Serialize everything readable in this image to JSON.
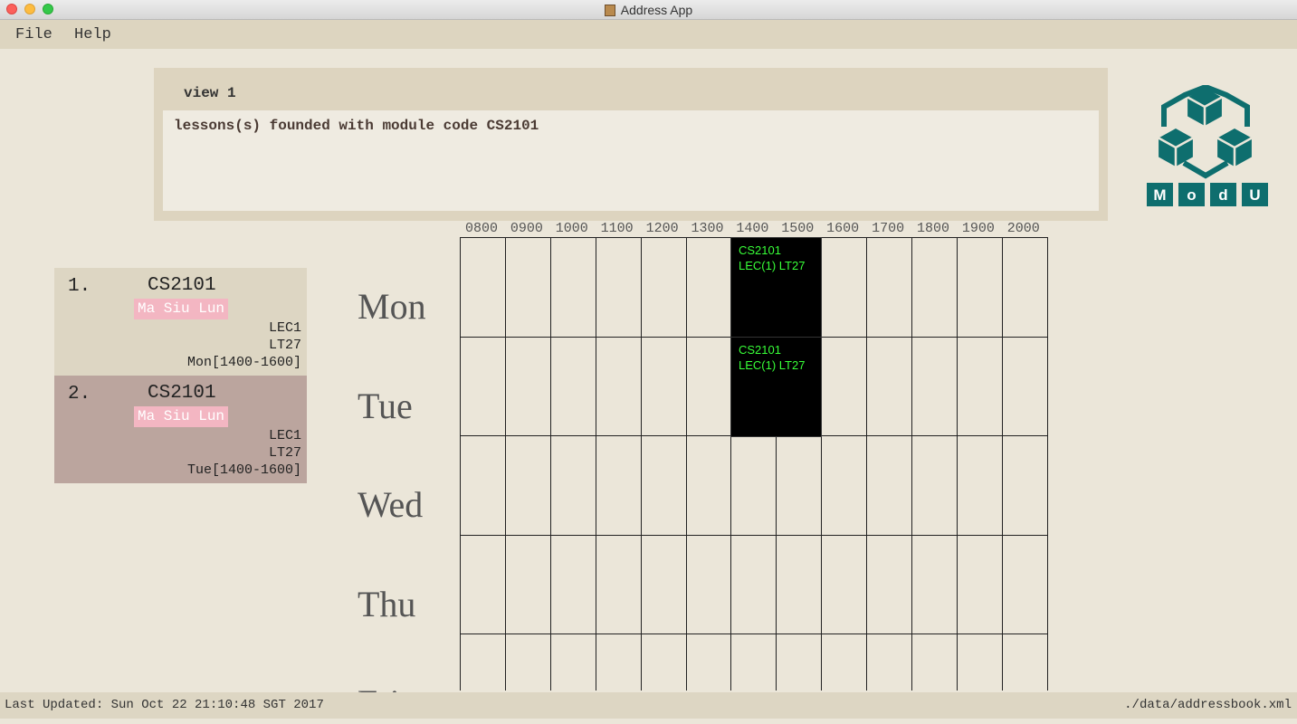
{
  "window": {
    "title": "Address App"
  },
  "menu": {
    "file": "File",
    "help": "Help"
  },
  "result": {
    "view_label": "view 1",
    "message": "lessons(s) founded with module code CS2101"
  },
  "logo": {
    "letters": [
      "M",
      "o",
      "d",
      "U"
    ],
    "color": "#0e6e6e"
  },
  "lessons": [
    {
      "index": "1.",
      "code": "CS2101",
      "tag": "Ma Siu Lun",
      "type": "LEC1",
      "venue": "LT27",
      "time": "Mon[1400-1600]"
    },
    {
      "index": "2.",
      "code": "CS2101",
      "tag": "Ma Siu Lun",
      "type": "LEC1",
      "venue": "LT27",
      "time": "Tue[1400-1600]"
    }
  ],
  "timetable": {
    "times": [
      "0800",
      "0900",
      "1000",
      "1100",
      "1200",
      "1300",
      "1400",
      "1500",
      "1600",
      "1700",
      "1800",
      "1900",
      "2000"
    ],
    "days": [
      "Mon",
      "Tue",
      "Wed",
      "Thu",
      "Fri"
    ],
    "blocks": [
      {
        "day": "Mon",
        "start": "1400",
        "end": "1600",
        "code": "CS2101",
        "info": "LEC(1) LT27"
      },
      {
        "day": "Tue",
        "start": "1400",
        "end": "1600",
        "code": "CS2101",
        "info": "LEC(1) LT27"
      }
    ]
  },
  "status": {
    "last_updated": "Last Updated: Sun Oct 22 21:10:48 SGT 2017",
    "path": "./data/addressbook.xml"
  }
}
